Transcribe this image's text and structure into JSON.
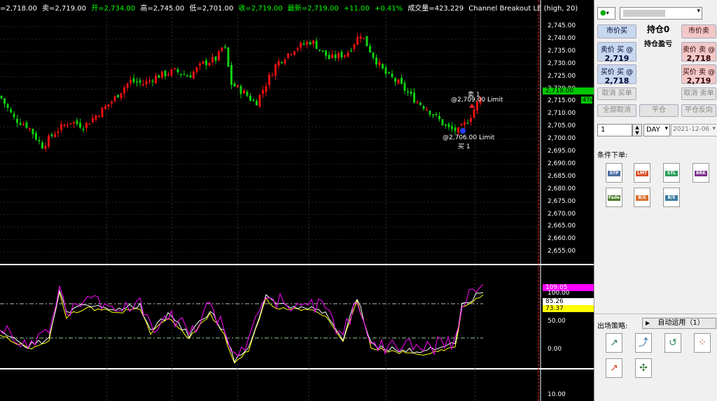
{
  "infobar": {
    "bid": "=2,718.00",
    "ask_label": "卖=",
    "ask": "2,719.00",
    "open_label": "开=",
    "open": "2,734.00",
    "high_label": "高=",
    "high": "2,745.00",
    "low_label": "低=",
    "low": "2,701.00",
    "close_label": "收=",
    "close": "2,719.00",
    "last_label": "最新=",
    "last": "2,719.00",
    "change": "+11.00",
    "change_pct": "+0.41%",
    "volume_label": "成交量=",
    "volume": "423,229",
    "strategy": "Channel Breakout LE (high,  20)"
  },
  "price_axis": [
    "2,745.00",
    "2,740.00",
    "2,735.00",
    "2,730.00",
    "2,725.00",
    "2,720.00",
    "2,715.00",
    "2,710.00",
    "2,705.00",
    "2,700.00",
    "2,695.00",
    "2,690.00",
    "2,685.00",
    "2,680.00",
    "2,675.00",
    "2,670.00",
    "2,665.00",
    "2,660.00",
    "2,655.00"
  ],
  "last_price_badge": "2,719.00",
  "side_badge": "47s",
  "orders": {
    "sell_qty": "卖 1",
    "sell_price": "@2,709.00 Limit",
    "buy_price": "@2,706.00 Limit",
    "buy_qty": "买 1"
  },
  "indicator": {
    "badge_magenta": "109.05",
    "badge_white": "85.26",
    "badge_yellow": "73.37",
    "axis": [
      "100.00",
      "50.00",
      "0.00"
    ],
    "bottom_axis": "10.00"
  },
  "colors": {
    "up": "#e81010",
    "down": "#10d010",
    "accent": "#00ff00",
    "magenta": "#ff00ff",
    "yellow": "#ffff00"
  },
  "panel": {
    "market_buy": "市价买",
    "position": "持仓0",
    "market_sell": "市价卖",
    "pnl": "持仓盈亏",
    "sell_at_buy_label": "卖价 买 @",
    "sell_at_buy_price": "2,719",
    "sell_at_sell_label": "卖价 卖 @",
    "sell_at_sell_price": "2,718",
    "buy_at_buy_label": "买价 买 @",
    "buy_at_buy_price": "2,718",
    "buy_at_sell_label": "买价 卖 @",
    "buy_at_sell_price": "2,719",
    "cancel_buy": "取消 买单",
    "cancel_sell": "取消 卖单",
    "cancel_all": "全部取消",
    "flatten": "平仓",
    "reverse": "平仓反向",
    "qty": "1",
    "duration": "DAY",
    "date": "2021-12-06",
    "conditional_orders": "条件下单:",
    "cond_icons": [
      "STP",
      "LMT",
      "STL",
      "BRK",
      "Fade",
      "B/S Rev",
      "B/S Sell"
    ],
    "exit_strategy": "出场策略:",
    "auto_apply": "自动运用（1）"
  }
}
